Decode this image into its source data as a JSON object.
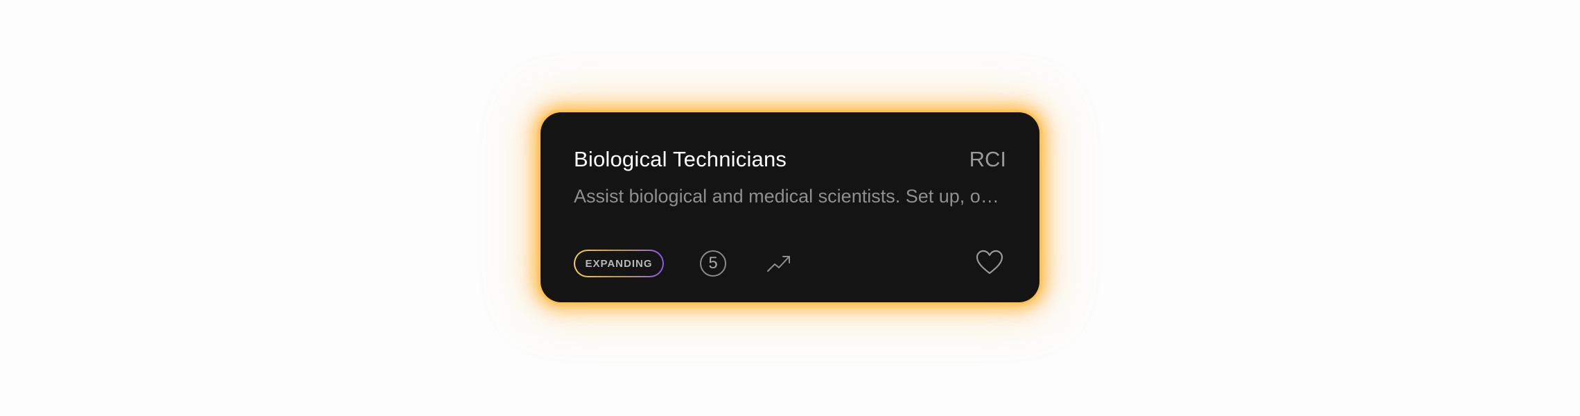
{
  "card": {
    "title": "Biological Technicians",
    "code": "RCI",
    "description": "Assist biological and medical scientists. Set up, operate, and maintain laboratory instruments and equipment.",
    "status_badge": "EXPANDING",
    "count": "5",
    "trend_icon": "trending-up-icon",
    "favorite_icon": "heart-outline-icon"
  },
  "colors": {
    "card_background": "#141414",
    "glow": "#ffb43c",
    "badge_gradient_start": "#f3d544",
    "badge_gradient_end": "#8d55f0"
  }
}
